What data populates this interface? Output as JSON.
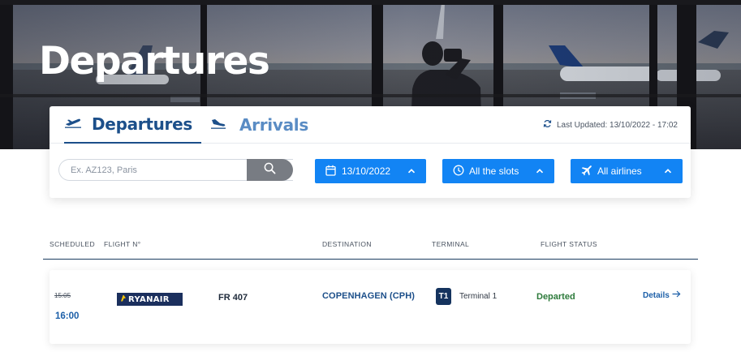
{
  "hero": {
    "title": "Departures"
  },
  "tabs": {
    "departures": "Departures",
    "arrivals": "Arrivals"
  },
  "last_updated": "Last Updated: 13/10/2022 - 17:02",
  "search": {
    "placeholder": "Ex. AZ123, Paris"
  },
  "filters": {
    "date": "13/10/2022",
    "slots": "All the slots",
    "airlines": "All airlines"
  },
  "table": {
    "headers": {
      "scheduled": "SCHEDULED",
      "flight": "FLIGHT N°",
      "destination": "DESTINATION",
      "terminal": "TERMINAL",
      "status": "FLIGHT STATUS"
    },
    "rows": [
      {
        "scheduled_original": "15:05",
        "scheduled_new": "16:00",
        "airline_logo": "RYANAIR",
        "flight_number": "FR 407",
        "destination": "COPENHAGEN (CPH)",
        "terminal_badge": "T1",
        "terminal_name": "Terminal 1",
        "status": "Departed",
        "details": "Details"
      }
    ]
  },
  "colors": {
    "primary_blue": "#1284f4",
    "navy": "#1c4f8a",
    "tab_inactive": "#5a8cc4",
    "status_green": "#2c7a3a",
    "badge_navy": "#15335e",
    "ryanair_navy": "#1b2f5d"
  },
  "icons": {
    "departures_tab": "plane-takeoff-icon",
    "arrivals_tab": "plane-landing-icon",
    "last_updated": "refresh-icon",
    "search_button": "search-icon",
    "date_filter": "calendar-icon",
    "slots_filter": "clock-icon",
    "airlines_filter": "plane-icon",
    "filter_toggle": "chevron-up-icon",
    "details": "arrow-right-icon"
  }
}
